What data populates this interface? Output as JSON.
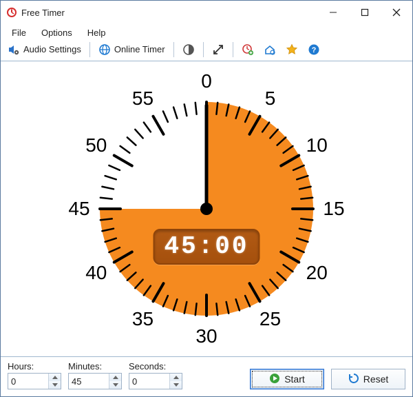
{
  "window": {
    "title": "Free Timer"
  },
  "menu": {
    "file": "File",
    "options": "Options",
    "help": "Help"
  },
  "toolbar": {
    "audio_settings": "Audio Settings",
    "online_timer": "Online Timer"
  },
  "dial": {
    "numbers": [
      "0",
      "5",
      "10",
      "15",
      "20",
      "25",
      "30",
      "35",
      "40",
      "45",
      "50",
      "55"
    ],
    "digital": "45:00",
    "fill_minutes": 45
  },
  "inputs": {
    "hours": {
      "label": "Hours:",
      "value": "0"
    },
    "minutes": {
      "label": "Minutes:",
      "value": "45"
    },
    "seconds": {
      "label": "Seconds:",
      "value": "0"
    }
  },
  "buttons": {
    "start": "Start",
    "reset": "Reset"
  },
  "colors": {
    "sector": "#f58a1f",
    "accent_blue": "#1f7ad1",
    "star": "#f3b21b"
  }
}
